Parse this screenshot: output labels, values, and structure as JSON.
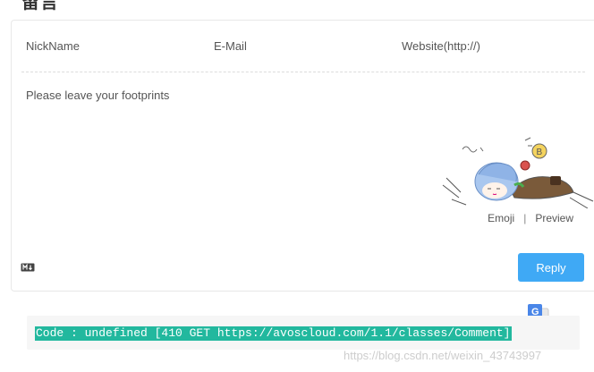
{
  "page": {
    "title": "留言"
  },
  "form": {
    "nick_placeholder": "NickName",
    "mail_placeholder": "E-Mail",
    "site_placeholder": "Website(http://)",
    "comment_placeholder": "Please leave your footprints",
    "emoji_label": "Emoji",
    "separator": "|",
    "preview_label": "Preview",
    "markdown_icon": "markdown-icon",
    "reply_label": "Reply",
    "colors": {
      "reply_bg": "#3fa9f5",
      "error_highlight": "#22b89e"
    }
  },
  "error": {
    "message": "Code : undefined [410 GET https://avoscloud.com/1.1/classes/Comment]"
  },
  "translate_icon": "google-translate-icon",
  "watermark": "https://blog.csdn.net/weixin_43743997"
}
